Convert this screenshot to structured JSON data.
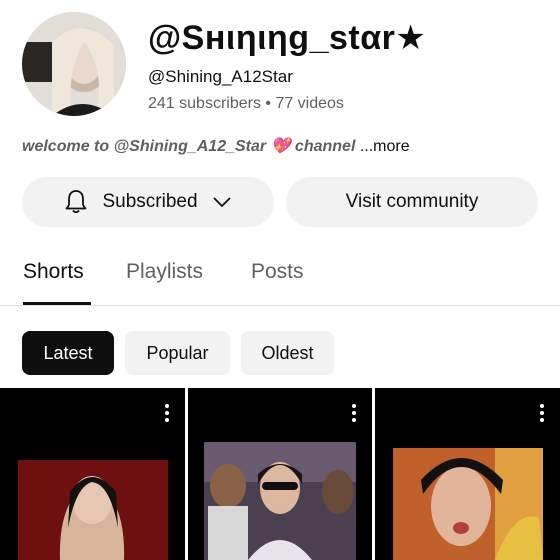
{
  "channel": {
    "name": "@Sнιηιηg_stαr★",
    "handle": "@Shining_A12Star",
    "stats": "241 subscribers • 77 videos",
    "description": "welcome to @Shining_A12_Star 💖 channel",
    "more_label": " ...more"
  },
  "actions": {
    "subscribed_label": "Subscribed",
    "visit_label": "Visit community"
  },
  "tabs": [
    {
      "label": "Shorts",
      "active": true
    },
    {
      "label": "Playlists",
      "active": false
    },
    {
      "label": "Posts",
      "active": false
    }
  ],
  "filters": [
    {
      "label": "Latest",
      "active": true
    },
    {
      "label": "Popular",
      "active": false
    },
    {
      "label": "Oldest",
      "active": false
    }
  ],
  "icons": {
    "bell": "bell-icon",
    "chevron": "chevron-down-icon",
    "more": "more-vertical-icon"
  },
  "colors": {
    "text": "#0f0f0f",
    "secondary": "#606060",
    "pill": "#f2f2f2",
    "chip_active": "#0f0f0f"
  }
}
